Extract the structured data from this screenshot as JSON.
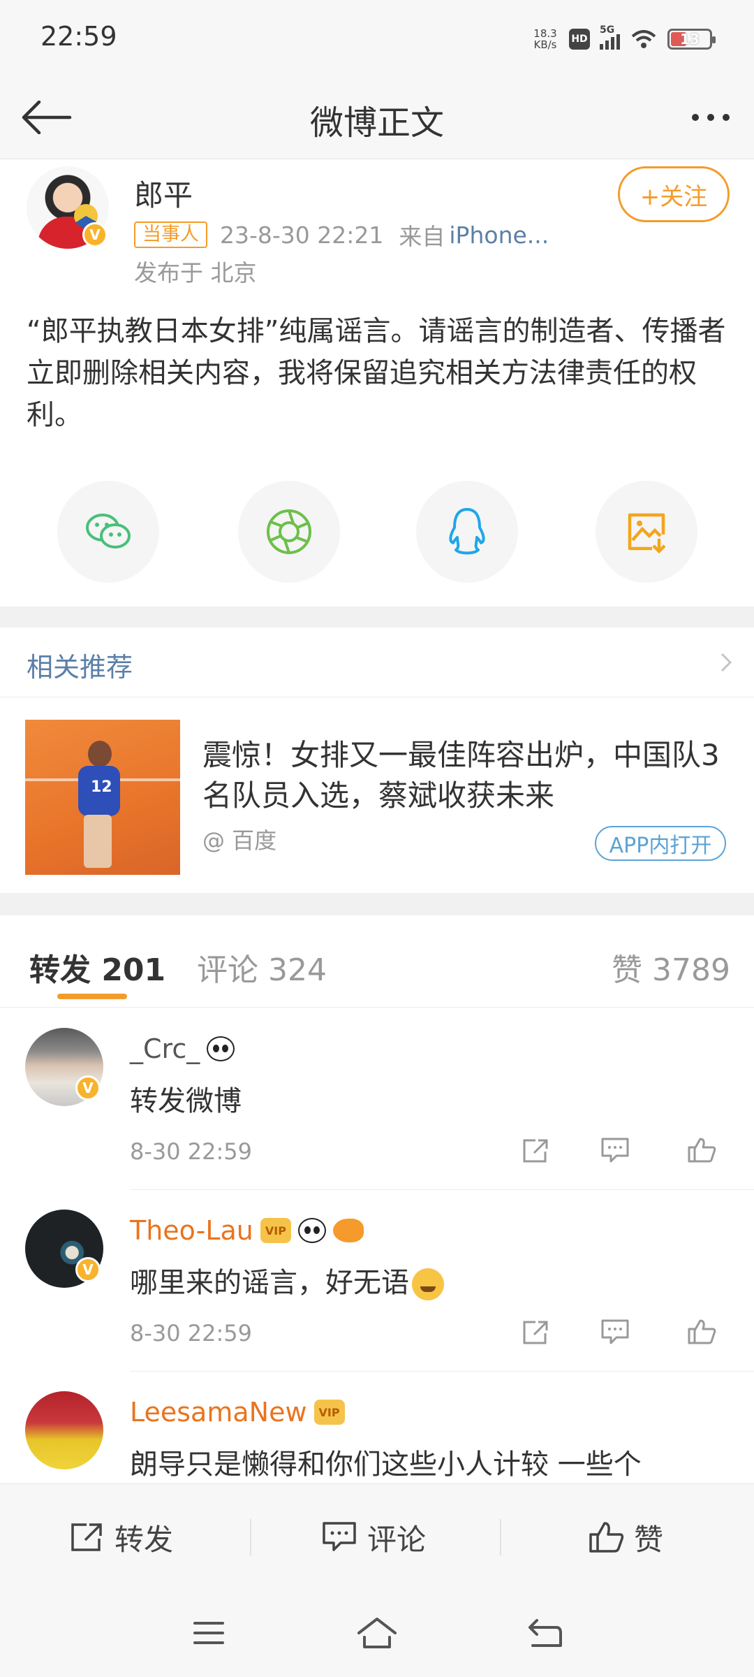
{
  "status_bar": {
    "time": "22:59",
    "net_speed_value": "18.3",
    "net_speed_unit": "KB/s",
    "hd": "HD",
    "network": "5G",
    "battery": "13"
  },
  "nav": {
    "title": "微博正文"
  },
  "post": {
    "author": "郎平",
    "follow_label": "+关注",
    "tag": "当事人",
    "time": "23-8-30 22:21",
    "from_label": "来自",
    "device": "iPhone...",
    "location": "发布于 北京",
    "text": "“郎平执教日本女排”纯属谣言。请谣言的制造者、传播者立即删除相关内容，我将保留追究相关方法律责任的权利。",
    "share_targets": [
      "wechat-icon",
      "moments-icon",
      "qq-icon",
      "save-image-icon"
    ]
  },
  "related": {
    "title": "相关推荐",
    "headline": "震惊！女排又一最佳阵容出炉，中国队3名队员入选，蔡斌收获未来",
    "source": "@ 百度",
    "open_in_app": "APP内打开",
    "thumb_jersey": "12"
  },
  "tabs": {
    "repost": "转发 201",
    "comment": "评论 324",
    "like": "赞 3789"
  },
  "reposts": [
    {
      "name": "_Crc_",
      "text": "转发微博",
      "time": "8-30 22:59"
    },
    {
      "name": "Theo-Lau",
      "text": "哪里来的谣言，好无语",
      "time": "8-30 22:59"
    },
    {
      "name": "LeesamaNew",
      "text": "朗导只是懒得和你们这些小人计较 一些个"
    }
  ],
  "action_bar": {
    "repost": "转发",
    "comment": "评论",
    "like": "赞"
  },
  "colors": {
    "accent_orange": "#f39c2c",
    "link_blue": "#5b7fa8",
    "username_orange": "#e9741e"
  }
}
